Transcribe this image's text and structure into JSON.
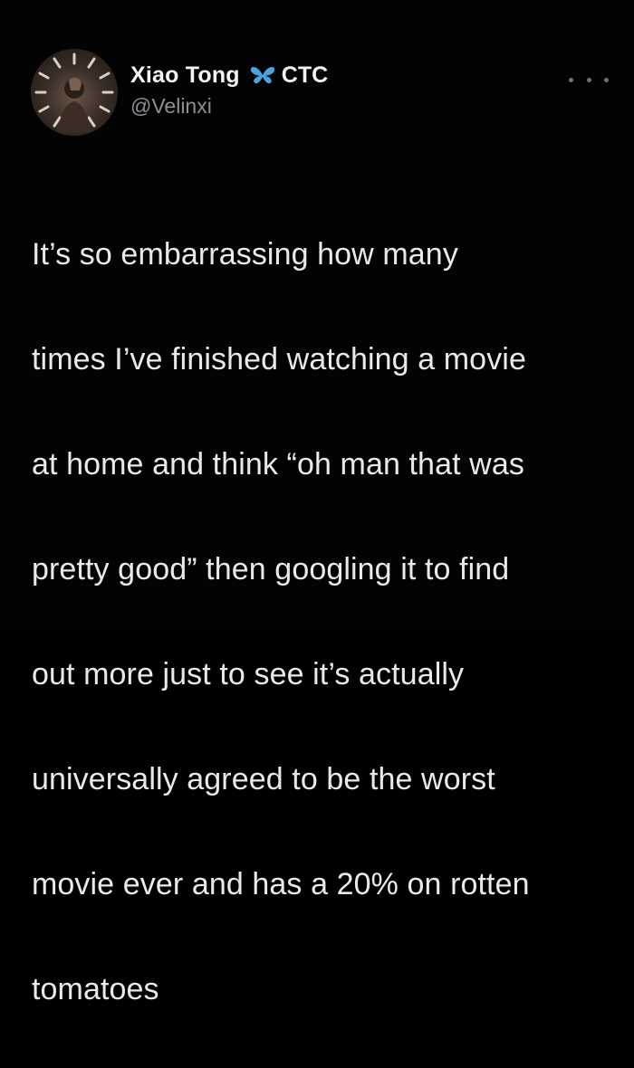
{
  "tweet": {
    "author": {
      "display_name": "Xiao Tong",
      "badge_icon": "butterfly-icon",
      "name_suffix": "CTC",
      "handle": "@Velinxi"
    },
    "more_icon": "more-options-icon",
    "body_lines": [
      "It’s so embarrassing how many",
      "times I’ve finished watching a movie",
      "at home and think “oh man that was",
      "pretty good” then googling it to find",
      "out more just to see it’s actually",
      "universally agreed to be the worst",
      "movie ever and has a 20% on rotten",
      "tomatoes"
    ]
  },
  "colors": {
    "background": "#030303",
    "text": "#e9e9e9",
    "handle": "#8b9095",
    "badge": "#4aa3df"
  }
}
